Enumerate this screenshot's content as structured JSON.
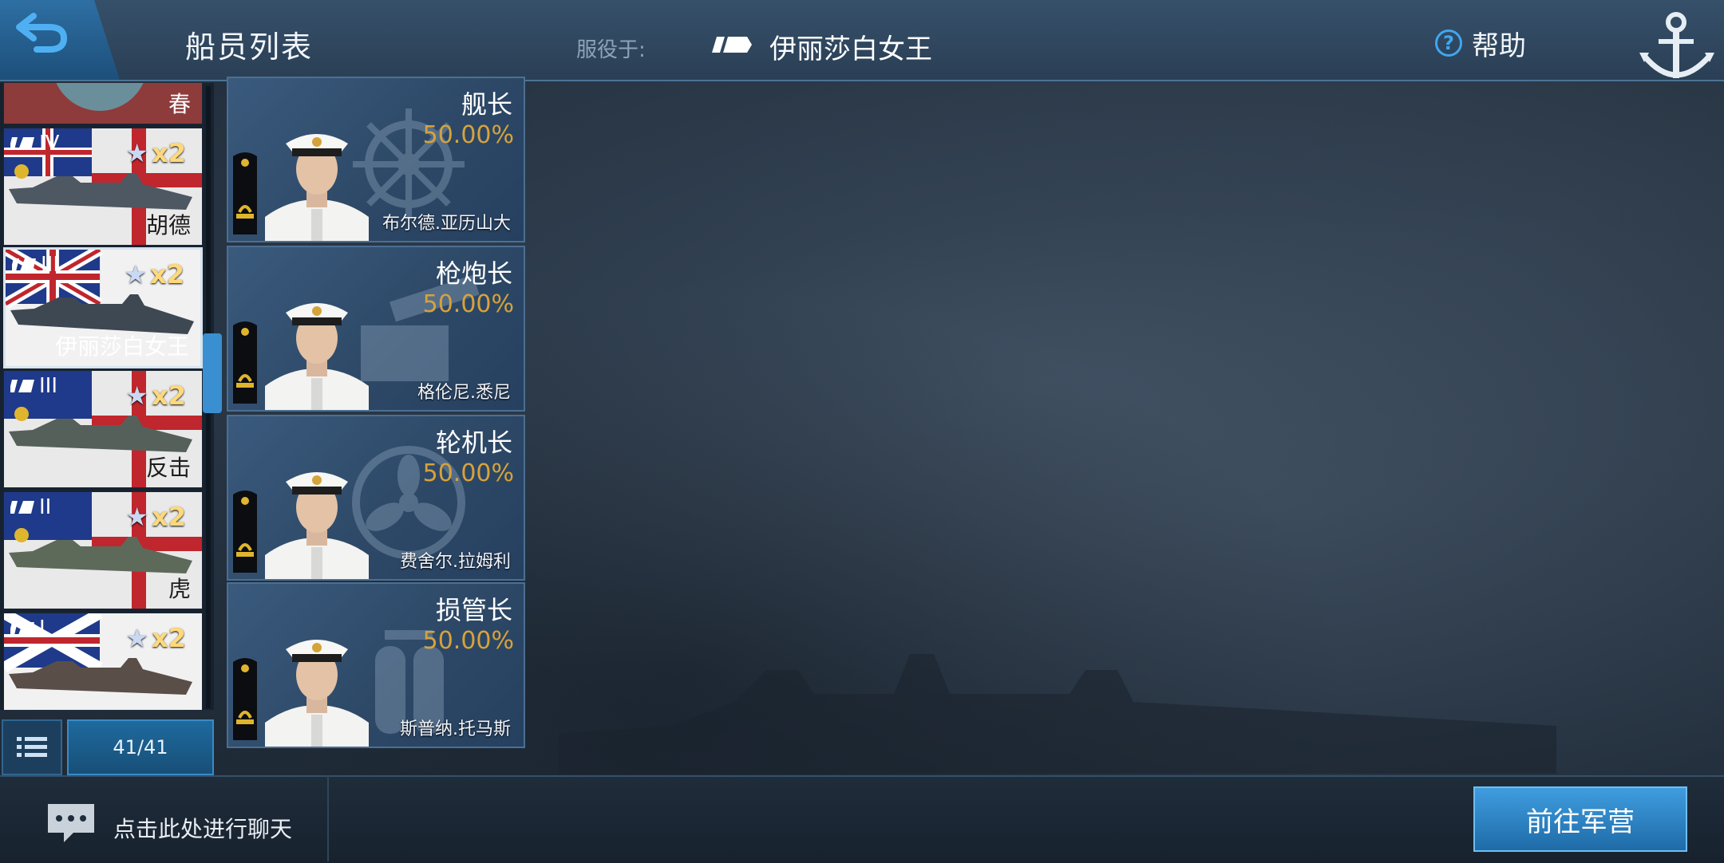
{
  "header": {
    "title": "船员列表",
    "serve_label": "服役于:",
    "serve_ship": "伊丽莎白女王",
    "help_label": "帮助"
  },
  "ships": [
    {
      "tier": "",
      "name": "春",
      "multiplier": ""
    },
    {
      "tier": "IV",
      "name": "胡德",
      "multiplier": "x2"
    },
    {
      "tier": "III",
      "name": "伊丽莎白女王",
      "multiplier": "x2"
    },
    {
      "tier": "III",
      "name": "反击",
      "multiplier": "x2"
    },
    {
      "tier": "II",
      "name": "虎",
      "multiplier": "x2"
    },
    {
      "tier": "I",
      "name": "",
      "multiplier": "x2"
    }
  ],
  "ship_count": "41/41",
  "crew": [
    {
      "role": "舰长",
      "percent": "50.00%",
      "name": "布尔德.亚历山大"
    },
    {
      "role": "枪炮长",
      "percent": "50.00%",
      "name": "格伦尼.悉尼"
    },
    {
      "role": "轮机长",
      "percent": "50.00%",
      "name": "费舍尔.拉姆利"
    },
    {
      "role": "损管长",
      "percent": "50.00%",
      "name": "斯普纳.托马斯"
    }
  ],
  "footer": {
    "chat_prompt": "点击此处进行聊天",
    "go_barracks": "前往军营"
  },
  "colors": {
    "accent": "#3fa6f0",
    "percent": "#d7a23b",
    "multiplier": "#ffd979"
  }
}
